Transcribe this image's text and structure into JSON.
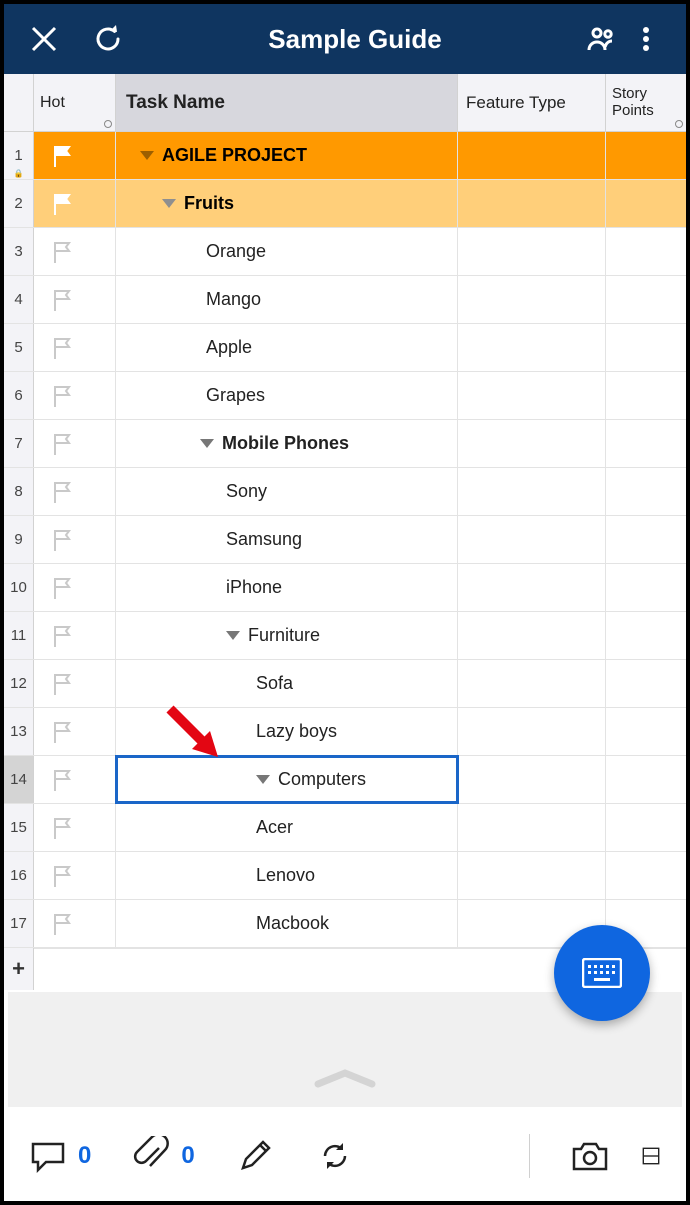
{
  "header": {
    "title": "Sample Guide"
  },
  "columns": {
    "hot": "Hot",
    "task": "Task Name",
    "feature": "Feature Type",
    "story": "Story Points"
  },
  "rows": [
    {
      "num": "1",
      "level": 0,
      "flag": "solid",
      "tri": true,
      "bold": true,
      "indent": 0,
      "label": "AGILE PROJECT",
      "selected": false,
      "lock": true
    },
    {
      "num": "2",
      "level": 1,
      "flag": "solid",
      "tri": true,
      "bold": true,
      "indent": 1,
      "label": "Fruits",
      "selected": false
    },
    {
      "num": "3",
      "level": 9,
      "flag": "outline",
      "tri": false,
      "bold": false,
      "indent": 2,
      "label": "Orange",
      "selected": false
    },
    {
      "num": "4",
      "level": 9,
      "flag": "outline",
      "tri": false,
      "bold": false,
      "indent": 2,
      "label": "Mango",
      "selected": false
    },
    {
      "num": "5",
      "level": 9,
      "flag": "outline",
      "tri": false,
      "bold": false,
      "indent": 2,
      "label": "Apple",
      "selected": false
    },
    {
      "num": "6",
      "level": 9,
      "flag": "outline",
      "tri": false,
      "bold": false,
      "indent": 2,
      "label": "Grapes",
      "selected": false
    },
    {
      "num": "7",
      "level": 9,
      "flag": "outline",
      "tri": true,
      "bold": true,
      "indent": 3,
      "label": "Mobile Phones",
      "selected": false
    },
    {
      "num": "8",
      "level": 9,
      "flag": "outline",
      "tri": false,
      "bold": false,
      "indent": 4,
      "label": "Sony",
      "selected": false
    },
    {
      "num": "9",
      "level": 9,
      "flag": "outline",
      "tri": false,
      "bold": false,
      "indent": 4,
      "label": "Samsung",
      "selected": false
    },
    {
      "num": "10",
      "level": 9,
      "flag": "outline",
      "tri": false,
      "bold": false,
      "indent": 4,
      "label": "iPhone",
      "selected": false
    },
    {
      "num": "11",
      "level": 9,
      "flag": "outline",
      "tri": true,
      "bold": false,
      "indent": 4,
      "label": "Furniture",
      "selected": false
    },
    {
      "num": "12",
      "level": 9,
      "flag": "outline",
      "tri": false,
      "bold": false,
      "indent": 5,
      "label": "Sofa",
      "selected": false
    },
    {
      "num": "13",
      "level": 9,
      "flag": "outline",
      "tri": false,
      "bold": false,
      "indent": 5,
      "label": "Lazy boys",
      "selected": false
    },
    {
      "num": "14",
      "level": 9,
      "flag": "outline",
      "tri": true,
      "bold": false,
      "indent": 5,
      "label": "Computers",
      "selected": true,
      "highlight": true
    },
    {
      "num": "15",
      "level": 9,
      "flag": "outline",
      "tri": false,
      "bold": false,
      "indent": 5,
      "label": "Acer",
      "selected": false
    },
    {
      "num": "16",
      "level": 9,
      "flag": "outline",
      "tri": false,
      "bold": false,
      "indent": 5,
      "label": "Lenovo",
      "selected": false
    },
    {
      "num": "17",
      "level": 9,
      "flag": "outline",
      "tri": false,
      "bold": false,
      "indent": 5,
      "label": "Macbook",
      "selected": false
    }
  ],
  "addrow": "+",
  "bottom": {
    "comments": "0",
    "attachments": "0"
  }
}
